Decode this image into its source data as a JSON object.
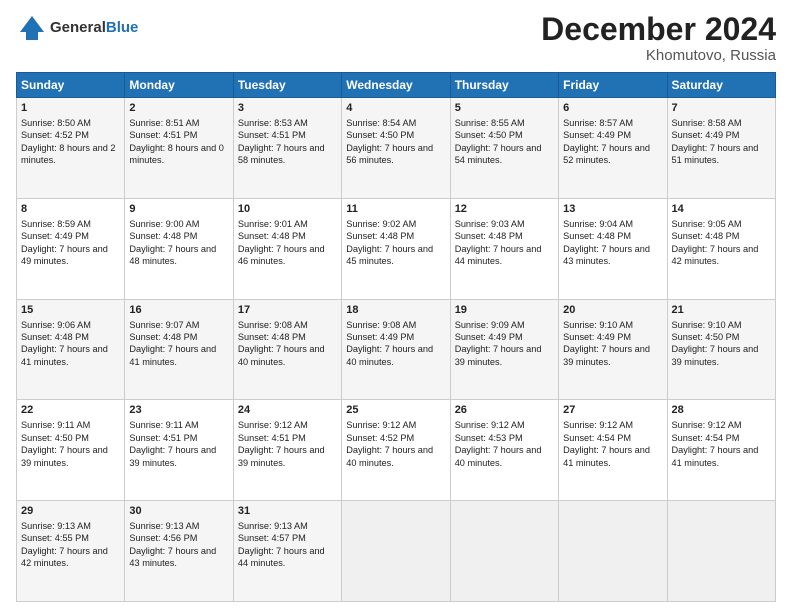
{
  "header": {
    "logo_general": "General",
    "logo_blue": "Blue",
    "title": "December 2024",
    "subtitle": "Khomutovo, Russia"
  },
  "days": [
    "Sunday",
    "Monday",
    "Tuesday",
    "Wednesday",
    "Thursday",
    "Friday",
    "Saturday"
  ],
  "weeks": [
    [
      {
        "day": "1",
        "sunrise": "Sunrise: 8:50 AM",
        "sunset": "Sunset: 4:52 PM",
        "daylight": "Daylight: 8 hours and 2 minutes."
      },
      {
        "day": "2",
        "sunrise": "Sunrise: 8:51 AM",
        "sunset": "Sunset: 4:51 PM",
        "daylight": "Daylight: 8 hours and 0 minutes."
      },
      {
        "day": "3",
        "sunrise": "Sunrise: 8:53 AM",
        "sunset": "Sunset: 4:51 PM",
        "daylight": "Daylight: 7 hours and 58 minutes."
      },
      {
        "day": "4",
        "sunrise": "Sunrise: 8:54 AM",
        "sunset": "Sunset: 4:50 PM",
        "daylight": "Daylight: 7 hours and 56 minutes."
      },
      {
        "day": "5",
        "sunrise": "Sunrise: 8:55 AM",
        "sunset": "Sunset: 4:50 PM",
        "daylight": "Daylight: 7 hours and 54 minutes."
      },
      {
        "day": "6",
        "sunrise": "Sunrise: 8:57 AM",
        "sunset": "Sunset: 4:49 PM",
        "daylight": "Daylight: 7 hours and 52 minutes."
      },
      {
        "day": "7",
        "sunrise": "Sunrise: 8:58 AM",
        "sunset": "Sunset: 4:49 PM",
        "daylight": "Daylight: 7 hours and 51 minutes."
      }
    ],
    [
      {
        "day": "8",
        "sunrise": "Sunrise: 8:59 AM",
        "sunset": "Sunset: 4:49 PM",
        "daylight": "Daylight: 7 hours and 49 minutes."
      },
      {
        "day": "9",
        "sunrise": "Sunrise: 9:00 AM",
        "sunset": "Sunset: 4:48 PM",
        "daylight": "Daylight: 7 hours and 48 minutes."
      },
      {
        "day": "10",
        "sunrise": "Sunrise: 9:01 AM",
        "sunset": "Sunset: 4:48 PM",
        "daylight": "Daylight: 7 hours and 46 minutes."
      },
      {
        "day": "11",
        "sunrise": "Sunrise: 9:02 AM",
        "sunset": "Sunset: 4:48 PM",
        "daylight": "Daylight: 7 hours and 45 minutes."
      },
      {
        "day": "12",
        "sunrise": "Sunrise: 9:03 AM",
        "sunset": "Sunset: 4:48 PM",
        "daylight": "Daylight: 7 hours and 44 minutes."
      },
      {
        "day": "13",
        "sunrise": "Sunrise: 9:04 AM",
        "sunset": "Sunset: 4:48 PM",
        "daylight": "Daylight: 7 hours and 43 minutes."
      },
      {
        "day": "14",
        "sunrise": "Sunrise: 9:05 AM",
        "sunset": "Sunset: 4:48 PM",
        "daylight": "Daylight: 7 hours and 42 minutes."
      }
    ],
    [
      {
        "day": "15",
        "sunrise": "Sunrise: 9:06 AM",
        "sunset": "Sunset: 4:48 PM",
        "daylight": "Daylight: 7 hours and 41 minutes."
      },
      {
        "day": "16",
        "sunrise": "Sunrise: 9:07 AM",
        "sunset": "Sunset: 4:48 PM",
        "daylight": "Daylight: 7 hours and 41 minutes."
      },
      {
        "day": "17",
        "sunrise": "Sunrise: 9:08 AM",
        "sunset": "Sunset: 4:48 PM",
        "daylight": "Daylight: 7 hours and 40 minutes."
      },
      {
        "day": "18",
        "sunrise": "Sunrise: 9:08 AM",
        "sunset": "Sunset: 4:49 PM",
        "daylight": "Daylight: 7 hours and 40 minutes."
      },
      {
        "day": "19",
        "sunrise": "Sunrise: 9:09 AM",
        "sunset": "Sunset: 4:49 PM",
        "daylight": "Daylight: 7 hours and 39 minutes."
      },
      {
        "day": "20",
        "sunrise": "Sunrise: 9:10 AM",
        "sunset": "Sunset: 4:49 PM",
        "daylight": "Daylight: 7 hours and 39 minutes."
      },
      {
        "day": "21",
        "sunrise": "Sunrise: 9:10 AM",
        "sunset": "Sunset: 4:50 PM",
        "daylight": "Daylight: 7 hours and 39 minutes."
      }
    ],
    [
      {
        "day": "22",
        "sunrise": "Sunrise: 9:11 AM",
        "sunset": "Sunset: 4:50 PM",
        "daylight": "Daylight: 7 hours and 39 minutes."
      },
      {
        "day": "23",
        "sunrise": "Sunrise: 9:11 AM",
        "sunset": "Sunset: 4:51 PM",
        "daylight": "Daylight: 7 hours and 39 minutes."
      },
      {
        "day": "24",
        "sunrise": "Sunrise: 9:12 AM",
        "sunset": "Sunset: 4:51 PM",
        "daylight": "Daylight: 7 hours and 39 minutes."
      },
      {
        "day": "25",
        "sunrise": "Sunrise: 9:12 AM",
        "sunset": "Sunset: 4:52 PM",
        "daylight": "Daylight: 7 hours and 40 minutes."
      },
      {
        "day": "26",
        "sunrise": "Sunrise: 9:12 AM",
        "sunset": "Sunset: 4:53 PM",
        "daylight": "Daylight: 7 hours and 40 minutes."
      },
      {
        "day": "27",
        "sunrise": "Sunrise: 9:12 AM",
        "sunset": "Sunset: 4:54 PM",
        "daylight": "Daylight: 7 hours and 41 minutes."
      },
      {
        "day": "28",
        "sunrise": "Sunrise: 9:12 AM",
        "sunset": "Sunset: 4:54 PM",
        "daylight": "Daylight: 7 hours and 41 minutes."
      }
    ],
    [
      {
        "day": "29",
        "sunrise": "Sunrise: 9:13 AM",
        "sunset": "Sunset: 4:55 PM",
        "daylight": "Daylight: 7 hours and 42 minutes."
      },
      {
        "day": "30",
        "sunrise": "Sunrise: 9:13 AM",
        "sunset": "Sunset: 4:56 PM",
        "daylight": "Daylight: 7 hours and 43 minutes."
      },
      {
        "day": "31",
        "sunrise": "Sunrise: 9:13 AM",
        "sunset": "Sunset: 4:57 PM",
        "daylight": "Daylight: 7 hours and 44 minutes."
      },
      null,
      null,
      null,
      null
    ]
  ]
}
